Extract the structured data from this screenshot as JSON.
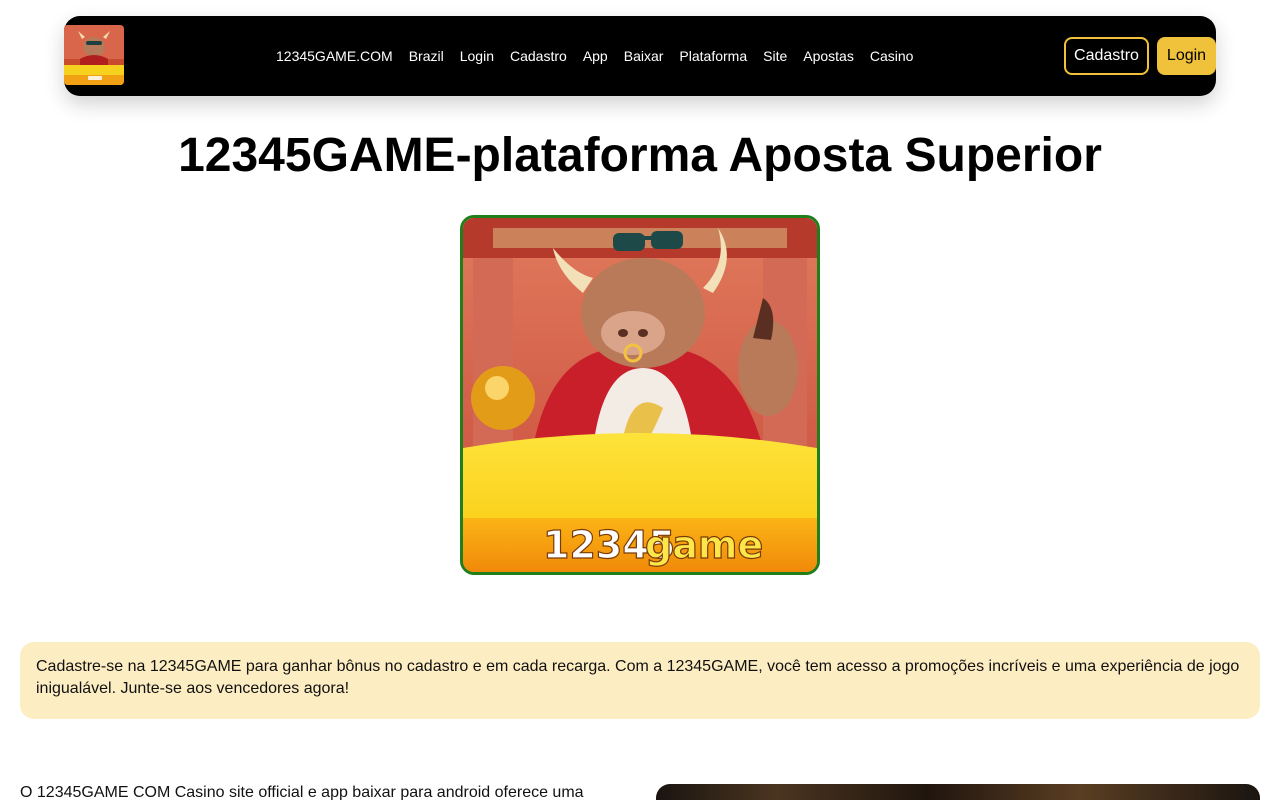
{
  "nav": {
    "links": [
      "12345GAME.COM",
      "Brazil",
      "Login",
      "Cadastro",
      "App",
      "Baixar",
      "Plataforma",
      "Site",
      "Apostas",
      "Casino"
    ],
    "cadastro_button": "Cadastro",
    "login_button": "Login"
  },
  "page_title": "12345GAME-plataforma Aposta Superior",
  "hero": {
    "logo_text_white": "12345",
    "logo_text_yellow": "game"
  },
  "promo_text": "Cadastre-se na 12345GAME para ganhar bônus no cadastro e em cada recarga. Com a 12345GAME, você tem acesso a promoções incríveis e uma experiência de jogo inigualável. Junte-se aos vencedores agora!",
  "intro_text": "O 12345GAME COM Casino site official e app baixar para android oferece uma",
  "colors": {
    "accent": "#f0c23b",
    "navbar_bg": "#000000",
    "promo_bg": "#fdedc2",
    "hero_border": "#1f7f1b"
  }
}
